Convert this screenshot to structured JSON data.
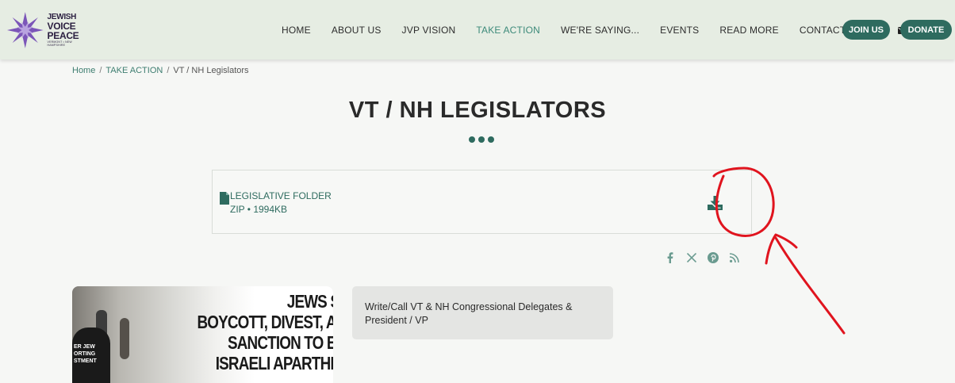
{
  "header": {
    "logo": {
      "line1": "JEWISH",
      "line2": "VOICE",
      "line3": "PEACE",
      "subline": "VERMONT • NEW HAMPSHIRE",
      "icon": "purple-star-flower-logo"
    },
    "nav": [
      {
        "label": "HOME"
      },
      {
        "label": "ABOUT US"
      },
      {
        "label": "JVP VISION"
      },
      {
        "label": "TAKE ACTION",
        "active": true
      },
      {
        "label": "WE'RE SAYING..."
      },
      {
        "label": "EVENTS"
      },
      {
        "label": "READ MORE"
      },
      {
        "label": "CONTACT US"
      }
    ],
    "share_icon": "share-icon",
    "mail_icon": "envelope-icon",
    "join_label": "JOIN US",
    "donate_label": "DONATE"
  },
  "breadcrumb": {
    "home": "Home",
    "sep": "/",
    "section": "TAKE ACTION",
    "current": "VT / NH Legislators"
  },
  "page": {
    "title": "VT / NH LEGISLATORS"
  },
  "file": {
    "name": "LEGISLATIVE FOLDER",
    "meta": "ZIP • 1994KB",
    "file_icon": "file-icon",
    "download_icon": "download-icon"
  },
  "share_links": [
    {
      "icon": "facebook-icon"
    },
    {
      "icon": "x-icon"
    },
    {
      "icon": "pinterest-icon"
    },
    {
      "icon": "rss-icon"
    }
  ],
  "content": {
    "photo_headline": [
      "JEWS S",
      "BOYCOTT, DIVEST, AI",
      "SANCTION TO EI",
      "ISRAELI APARTHE"
    ],
    "photo_sign": [
      "ER JEW",
      "ORTING",
      "STMENT"
    ],
    "info_text": "Write/Call VT & NH Congressional Delegates & President / VP"
  },
  "colors": {
    "accent": "#2e6b5f",
    "active_nav": "#3d8a7a",
    "header_bg": "#e6ede3",
    "annotation": "#e0141e"
  }
}
